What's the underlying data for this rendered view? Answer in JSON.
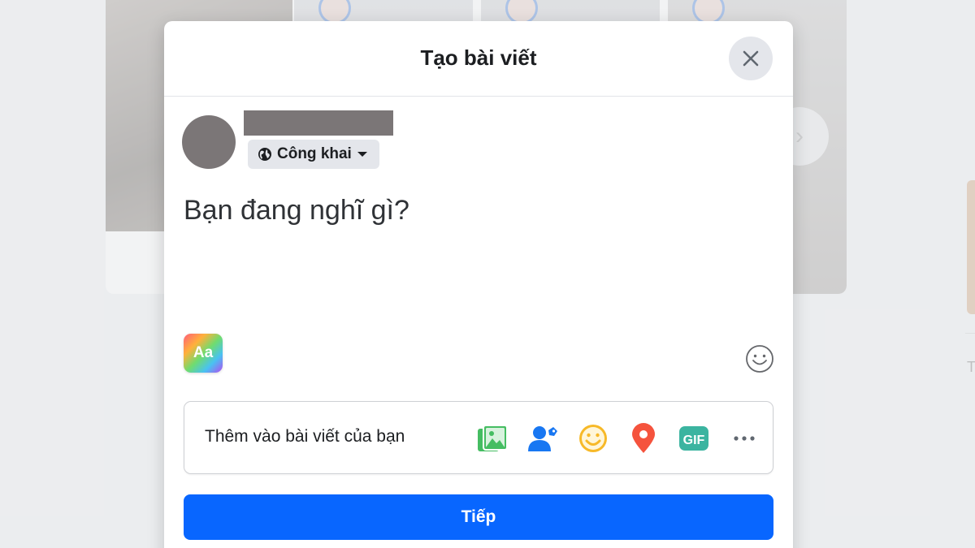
{
  "modal": {
    "title": "Tạo bài viết",
    "privacy_label": "Công khai",
    "composer_placeholder": "Bạn đang nghĩ gì?",
    "text_style_label": "Aa",
    "add_to_post_label": "Thêm vào bài viết của bạn",
    "add_icons": [
      "photo-video-icon",
      "tag-people-icon",
      "feeling-icon",
      "check-in-icon",
      "gif-icon",
      "more-icon"
    ],
    "gif_label": "GIF",
    "next_button_label": "Tiếp"
  },
  "background": {
    "partial_letter": "T"
  },
  "colors": {
    "primary": "#0866ff",
    "photo_green": "#45bd62",
    "tag_blue": "#1877f2",
    "feeling_yellow": "#f7b928",
    "checkin_red": "#f5533d",
    "gif_teal": "#3bb4a0"
  }
}
